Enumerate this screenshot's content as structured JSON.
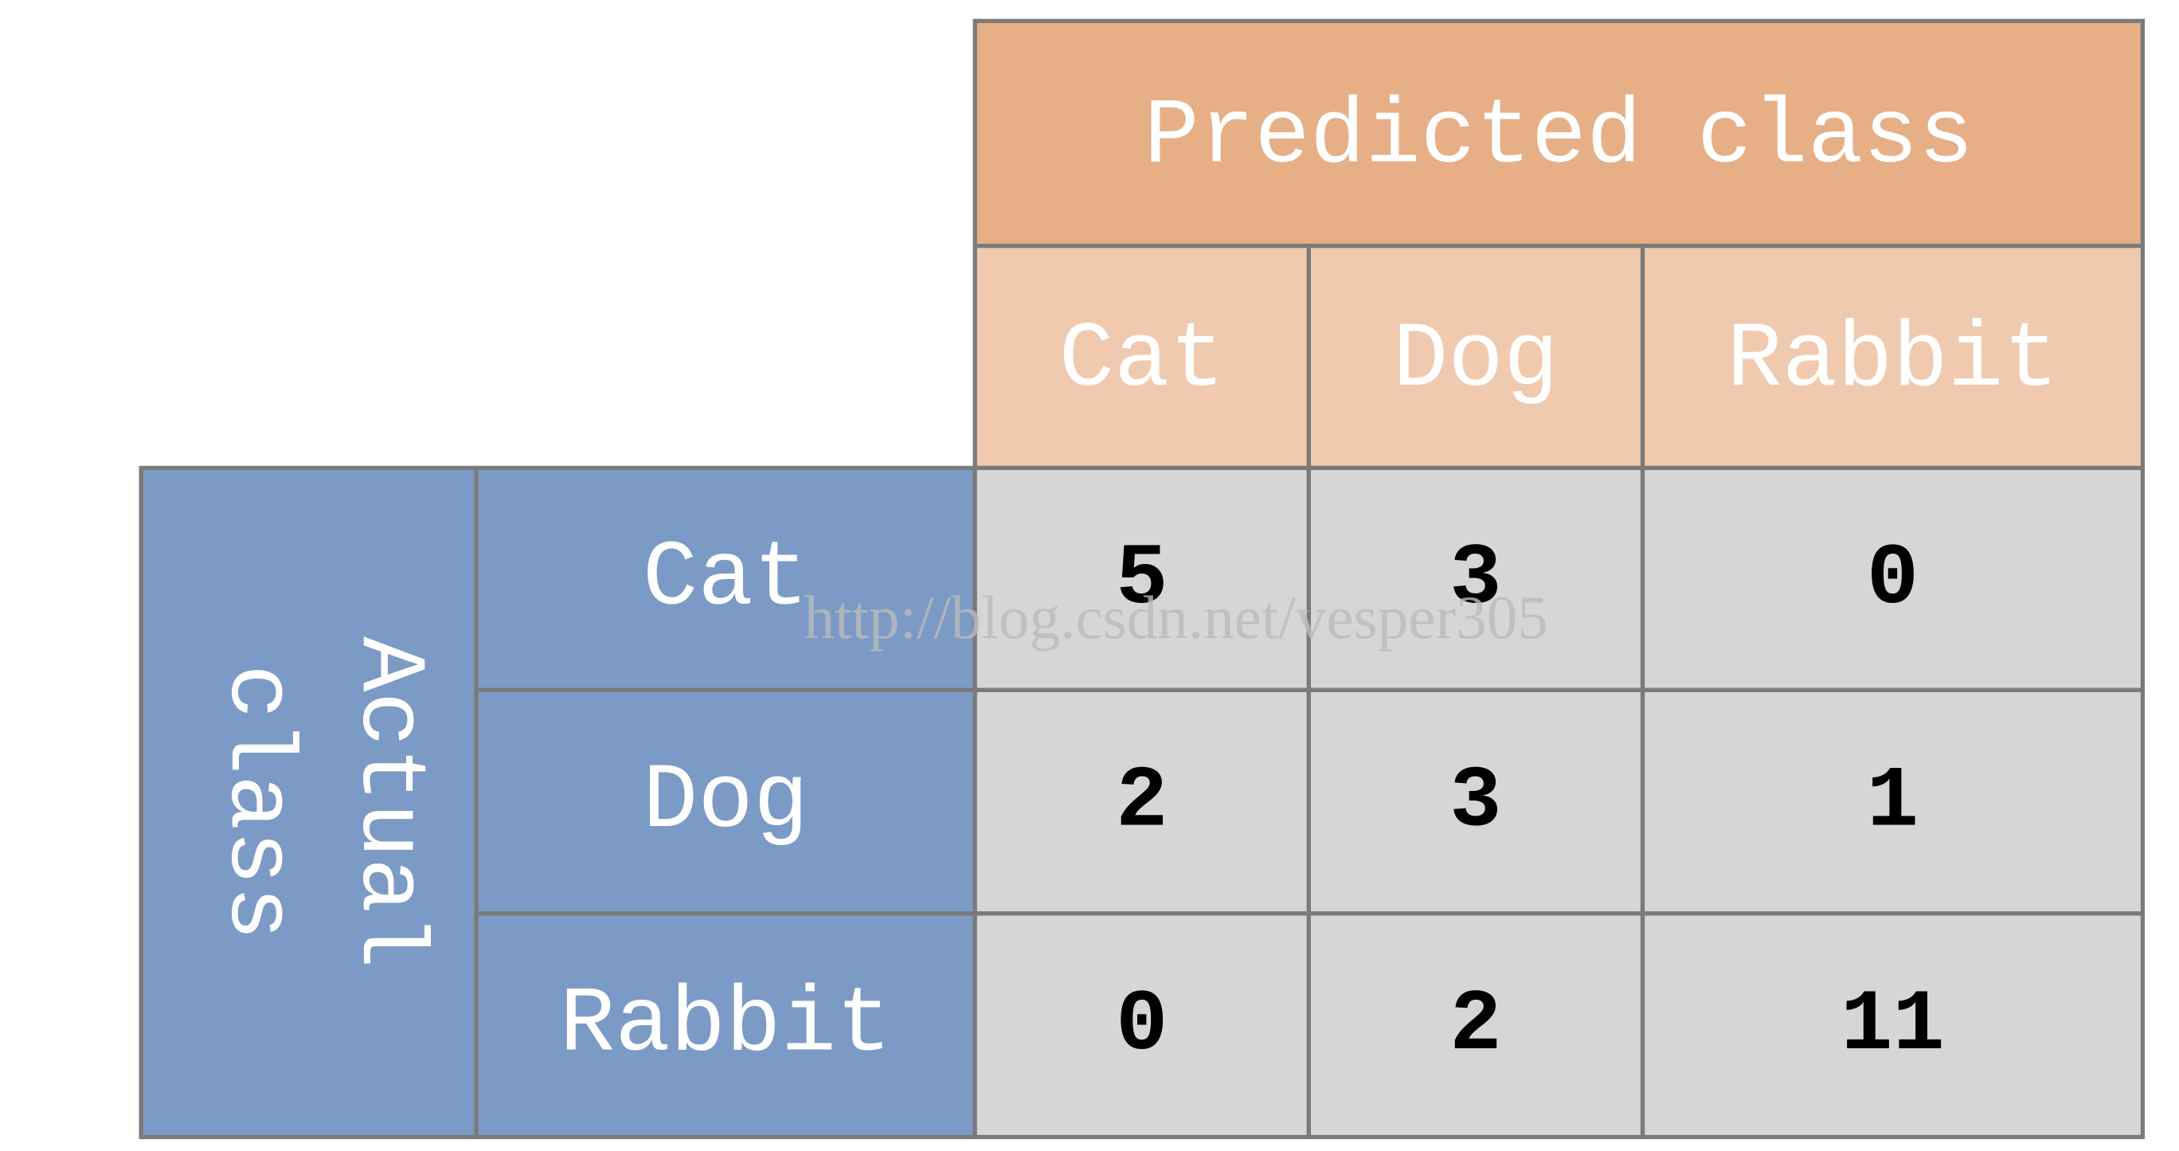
{
  "colors": {
    "predicted_header": "#E6AF86",
    "predicted_subheader": "#F0CAAE",
    "actual_header": "#7B9BC6",
    "cell": "#D6D6D6",
    "grid": "#7A7A7A",
    "header_text": "#FFFFFF",
    "value_text": "#000000",
    "watermark": "#BBBBBB"
  },
  "matrix": {
    "predicted_title": "Predicted class",
    "actual_title_line1": "Actual",
    "actual_title_line2": "class",
    "predicted_labels": [
      "Cat",
      "Dog",
      "Rabbit"
    ],
    "actual_labels": [
      "Cat",
      "Dog",
      "Rabbit"
    ],
    "values": [
      [
        "5",
        "3",
        "0"
      ],
      [
        "2",
        "3",
        "1"
      ],
      [
        "0",
        "2",
        "11"
      ]
    ]
  },
  "watermark": "http://blog.csdn.net/vesper305"
}
